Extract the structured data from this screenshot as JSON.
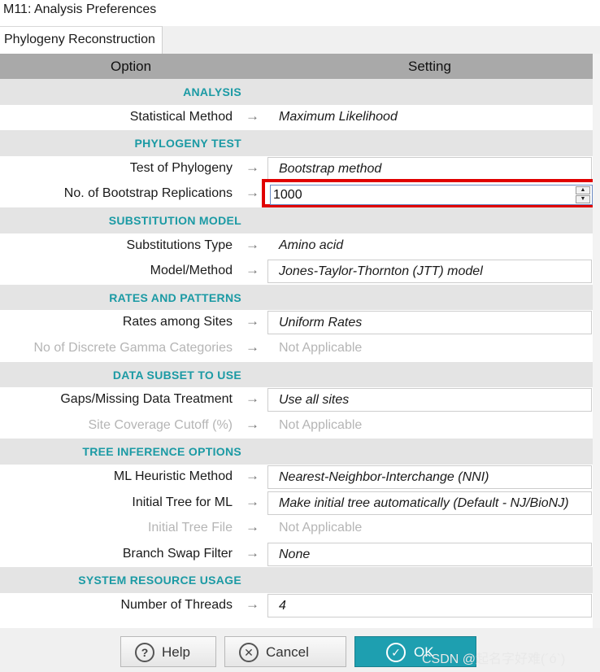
{
  "window": {
    "title": "M11: Analysis Preferences"
  },
  "tabs": [
    {
      "label": "Phylogeny Reconstruction"
    }
  ],
  "table": {
    "headers": {
      "option": "Option",
      "setting": "Setting"
    },
    "rows": [
      {
        "kind": "section",
        "label": "ANALYSIS"
      },
      {
        "kind": "item",
        "option": "Statistical Method",
        "value": "Maximum Likelihood",
        "control": "text"
      },
      {
        "kind": "section",
        "label": "PHYLOGENY TEST"
      },
      {
        "kind": "item",
        "option": "Test of Phylogeny",
        "value": "Bootstrap method",
        "control": "dropdown"
      },
      {
        "kind": "item",
        "option": "No. of Bootstrap Replications",
        "value": "1000",
        "control": "spin"
      },
      {
        "kind": "section",
        "label": "SUBSTITUTION MODEL"
      },
      {
        "kind": "item",
        "option": "Substitutions Type",
        "value": "Amino acid",
        "control": "text"
      },
      {
        "kind": "item",
        "option": "Model/Method",
        "value": "Jones-Taylor-Thornton (JTT) model",
        "control": "dropdown"
      },
      {
        "kind": "section",
        "label": "RATES AND PATTERNS"
      },
      {
        "kind": "item",
        "option": "Rates among Sites",
        "value": "Uniform Rates",
        "control": "dropdown"
      },
      {
        "kind": "item",
        "option": "No of Discrete Gamma Categories",
        "value": "Not Applicable",
        "control": "disabled"
      },
      {
        "kind": "section",
        "label": "DATA SUBSET TO USE"
      },
      {
        "kind": "item",
        "option": "Gaps/Missing Data Treatment",
        "value": "Use all sites",
        "control": "dropdown"
      },
      {
        "kind": "item",
        "option": "Site Coverage Cutoff (%)",
        "value": "Not Applicable",
        "control": "disabled"
      },
      {
        "kind": "section",
        "label": "TREE INFERENCE OPTIONS"
      },
      {
        "kind": "item",
        "option": "ML Heuristic Method",
        "value": "Nearest-Neighbor-Interchange (NNI)",
        "control": "dropdown"
      },
      {
        "kind": "item",
        "option": "Initial Tree for ML",
        "value": "Make initial tree automatically (Default - NJ/BioNJ)",
        "control": "dropdown"
      },
      {
        "kind": "item",
        "option": "Initial Tree File",
        "value": "Not Applicable",
        "control": "disabled"
      },
      {
        "kind": "item",
        "option": "Branch Swap Filter",
        "value": "None",
        "control": "dropdown"
      },
      {
        "kind": "section",
        "label": "SYSTEM RESOURCE USAGE"
      },
      {
        "kind": "item",
        "option": "Number of Threads",
        "value": "4",
        "control": "dropdown"
      }
    ]
  },
  "footer": {
    "help": "Help",
    "cancel": "Cancel",
    "ok": "OK",
    "watermark": "CSDN @起名字好难(´ó`)"
  },
  "icons": {
    "help": "question-circle-icon",
    "cancel": "x-circle-icon",
    "ok": "check-circle-icon",
    "arrow": "right-arrow-icon"
  },
  "colors": {
    "section_text": "#1b9aa4",
    "ok_button": "#1e9fb0",
    "highlight": "#e00000"
  }
}
